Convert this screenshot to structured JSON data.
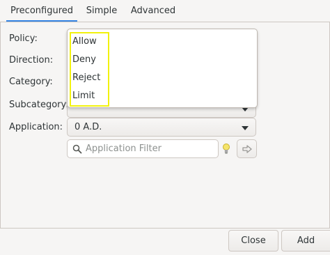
{
  "tabs": [
    {
      "label": "Preconfigured"
    },
    {
      "label": "Simple"
    },
    {
      "label": "Advanced"
    }
  ],
  "form": {
    "policy_label": "Policy:",
    "direction_label": "Direction:",
    "category_label": "Category:",
    "subcategory_label": "Subcategory:",
    "application_label": "Application:",
    "application_value": "0 A.D.",
    "filter_placeholder": "Application Filter"
  },
  "policy_options": [
    "Allow",
    "Deny",
    "Reject",
    "Limit"
  ],
  "buttons": {
    "close": "Close",
    "add": "Add"
  }
}
